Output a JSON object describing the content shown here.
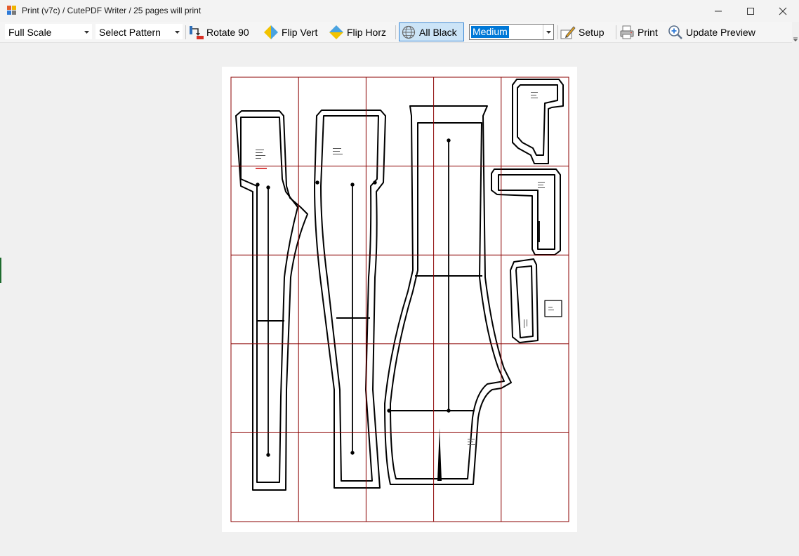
{
  "window": {
    "title": "Print (v7c)  /  CutePDF Writer  /  25 pages will print",
    "controls": [
      "minimize-icon",
      "maximize-icon",
      "close-icon"
    ]
  },
  "toolbar": {
    "scale_value": "Full Scale",
    "pattern_value": "Select Pattern",
    "rotate_label": "Rotate 90",
    "flip_vert_label": "Flip Vert",
    "flip_horz_label": "Flip Horz",
    "all_black_label": "All Black",
    "all_black_active": true,
    "line_weight_value": "Medium",
    "setup_label": "Setup",
    "print_label": "Print",
    "update_preview_label": "Update Preview"
  },
  "icons": {
    "rotate": "rotate-icon",
    "flip_vert": "flip-vertical-icon",
    "flip_horz": "flip-horizontal-icon",
    "all_black": "globe-icon",
    "setup": "setup-pencil-icon",
    "print": "printer-icon",
    "update_preview": "zoom-in-icon"
  },
  "preview": {
    "grid_columns": 5,
    "grid_rows": 5,
    "page_count": 25,
    "grid_color": "#8b0000",
    "pattern_color": "#000000"
  },
  "colors": {
    "accent": "#0078d7",
    "active_button_bg": "#cce4f7",
    "active_button_border": "#3e8ad6"
  }
}
